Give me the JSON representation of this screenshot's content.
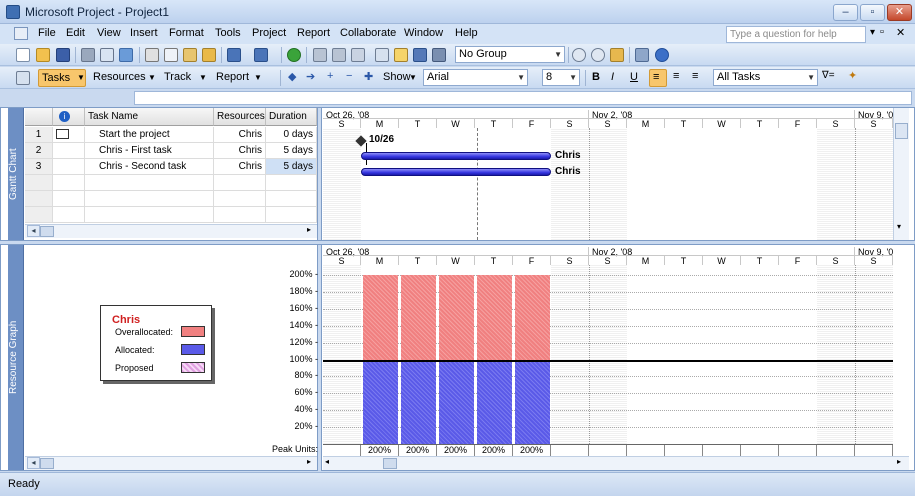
{
  "window": {
    "title": "Microsoft Project - Project1",
    "minimize": "‒",
    "restore": "▫",
    "close": "✕"
  },
  "menu": [
    "File",
    "Edit",
    "View",
    "Insert",
    "Format",
    "Tools",
    "Project",
    "Report",
    "Collaborate",
    "Window",
    "Help"
  ],
  "help_placeholder": "Type a question for help",
  "standard_toolbar": {
    "group_combo": "No Group"
  },
  "formatting_toolbar": {
    "tasks": "Tasks",
    "resources": "Resources",
    "track": "Track",
    "report": "Report",
    "show": "Show",
    "font": "Arial",
    "size": "8",
    "bold": "B",
    "italic": "I",
    "underline": "U",
    "filter": "All Tasks"
  },
  "gantt_table": {
    "headers": {
      "info": "i",
      "name": "Task Name",
      "resources": "Resources",
      "duration": "Duration"
    },
    "rows": [
      {
        "id": "1",
        "name": "Start the project",
        "resources": "Chris",
        "duration": "0 days"
      },
      {
        "id": "2",
        "name": "Chris - First task",
        "resources": "Chris",
        "duration": "5 days"
      },
      {
        "id": "3",
        "name": "Chris - Second task",
        "resources": "Chris",
        "duration": "5 days"
      }
    ]
  },
  "timescale": {
    "weeks": [
      "Oct 26, '08",
      "Nov 2, '08",
      "Nov 9, '0"
    ],
    "days": [
      "S",
      "M",
      "T",
      "W",
      "T",
      "F",
      "S",
      "S",
      "M",
      "T",
      "W",
      "T",
      "F",
      "S",
      "S"
    ]
  },
  "gantt_chart": {
    "milestone_label": "10/26",
    "bar_labels": [
      "Chris",
      "Chris"
    ]
  },
  "view_labels": {
    "top": "Gantt Chart",
    "bottom": "Resource Graph"
  },
  "resource_graph": {
    "legend": {
      "name": "Chris",
      "overallocated": "Overallocated:",
      "allocated": "Allocated:",
      "proposed": "Proposed"
    },
    "y_ticks": [
      "200% -",
      "180% -",
      "160% -",
      "140% -",
      "120% -",
      "100% -",
      "80% -",
      "60% -",
      "40% -",
      "20% -"
    ],
    "peak_label": "Peak Units:",
    "peak_values": [
      "200%",
      "200%",
      "200%",
      "200%",
      "200%"
    ],
    "colors": {
      "overallocated": "#f08080",
      "allocated": "#5a5ae8",
      "proposed": "#e0a0e0"
    }
  },
  "chart_data": {
    "type": "bar",
    "title": "Chris",
    "ylabel": "",
    "categories": [
      "S",
      "M",
      "T",
      "W",
      "T",
      "F",
      "S"
    ],
    "series": [
      {
        "name": "Allocated",
        "values": [
          0,
          100,
          100,
          100,
          100,
          100,
          0
        ]
      },
      {
        "name": "Overallocated",
        "values": [
          0,
          100,
          100,
          100,
          100,
          100,
          0
        ]
      }
    ],
    "ylim": [
      0,
      200
    ]
  },
  "status": "Ready"
}
